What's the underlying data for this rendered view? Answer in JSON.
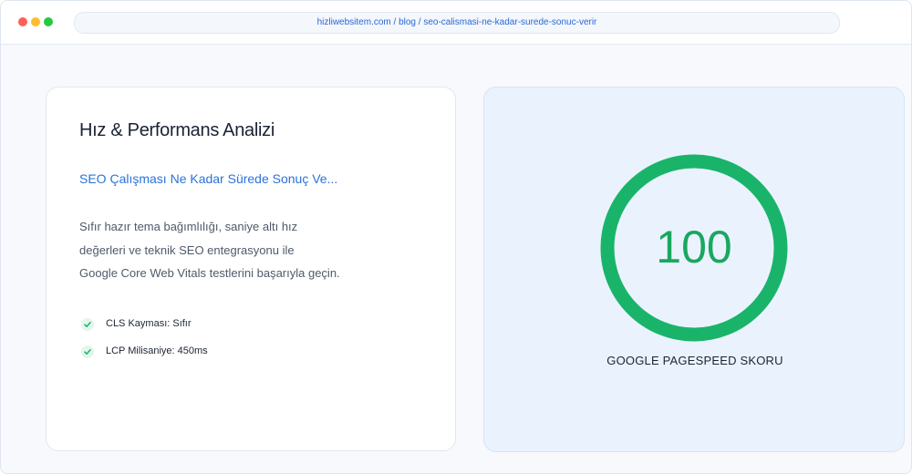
{
  "browser": {
    "url": "hizliwebsitem.com / blog / seo-calismasi-ne-kadar-surede-sonuc-verir"
  },
  "analysis_card": {
    "title": "Hız & Performans Analizi",
    "article_link": "SEO Çalışması Ne Kadar Sürede Sonuç Ve...",
    "description_lines": [
      "Sıfır hazır tema bağımlılığı, saniye altı hız",
      "değerleri ve teknik SEO entegrasyonu ile",
      "Google Core Web Vitals testlerini başarıyla geçin."
    ],
    "checklist": [
      {
        "label": "CLS Kayması: Sıfır",
        "icon": "check-icon"
      },
      {
        "label": "LCP Milisaniye: 450ms",
        "icon": "check-icon"
      }
    ]
  },
  "score_card": {
    "score": "100",
    "score_fraction": 1.0,
    "label": "GOOGLE PAGESPEED SKORU"
  },
  "colors": {
    "accent_green": "#19b46a",
    "link_blue": "#2a73d8",
    "score_panel_bg": "#eaf3fd"
  }
}
